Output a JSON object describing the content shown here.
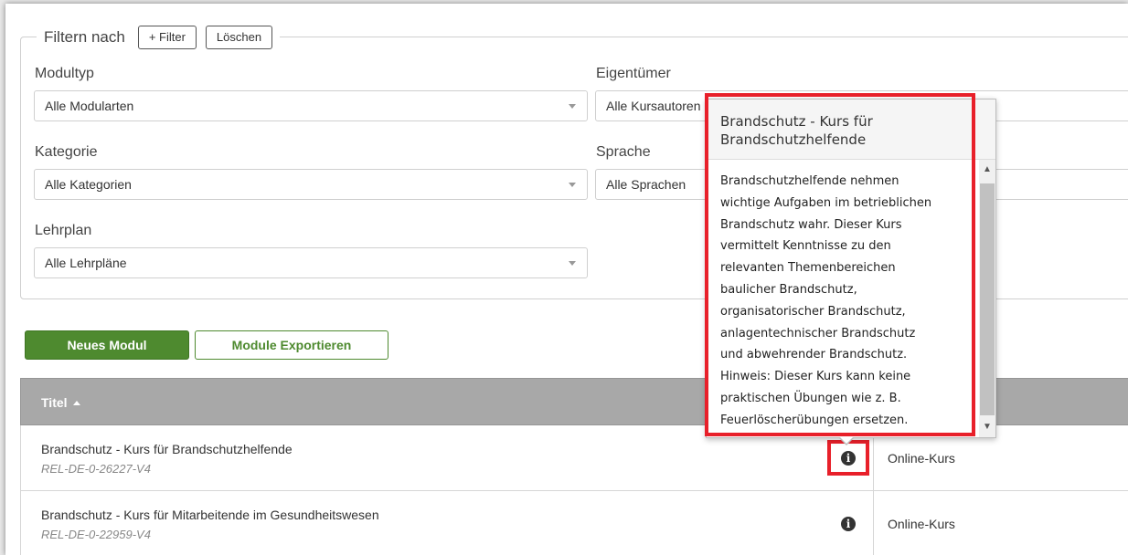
{
  "filter": {
    "legend": "Filtern nach",
    "add_filter_label": "+ Filter",
    "clear_label": "Löschen",
    "fields": {
      "modultyp": {
        "label": "Modultyp",
        "value": "Alle Modularten"
      },
      "eigentuemer": {
        "label": "Eigentümer",
        "value": "Alle Kursautoren"
      },
      "kategorie": {
        "label": "Kategorie",
        "value": "Alle Kategorien"
      },
      "sprache": {
        "label": "Sprache",
        "value": "Alle Sprachen"
      },
      "lehrplan": {
        "label": "Lehrplan",
        "value": "Alle Lehrpläne"
      }
    }
  },
  "actions": {
    "new_module": "Neues Modul",
    "export_modules": "Module Exportieren"
  },
  "table": {
    "header_title": "Titel",
    "rows": [
      {
        "title": "Brandschutz - Kurs für Brandschutzhelfende",
        "code": "REL-DE-0-26227-V4",
        "type": "Online-Kurs"
      },
      {
        "title": "Brandschutz - Kurs für Mitarbeitende im Gesundheitswesen",
        "code": "REL-DE-0-22959-V4",
        "type": "Online-Kurs"
      }
    ]
  },
  "popover": {
    "title": "Brandschutz - Kurs für Brandschutzhelfende",
    "body_lines": [
      "Brandschutzhelfende nehmen",
      "wichtige Aufgaben im betrieblichen",
      "Brandschutz wahr. Dieser Kurs",
      "vermittelt Kenntnisse zu den",
      "relevanten Themenbereichen",
      "baulicher Brandschutz,",
      "organisatorischer Brandschutz,",
      "anlagentechnischer Brandschutz",
      "und abwehrender Brandschutz.",
      "Hinweis: Dieser Kurs kann keine",
      "praktischen Übungen wie z. B.",
      "Feuerlöscherübungen ersetzen."
    ]
  },
  "icons": {
    "info": "info-circle-icon",
    "caret": "chevron-down-icon",
    "sort": "sort-ascending-icon"
  },
  "colors": {
    "primary_green": "#4e8a2f",
    "table_header": "#a8a8a8",
    "highlight_red": "#e8202a"
  }
}
